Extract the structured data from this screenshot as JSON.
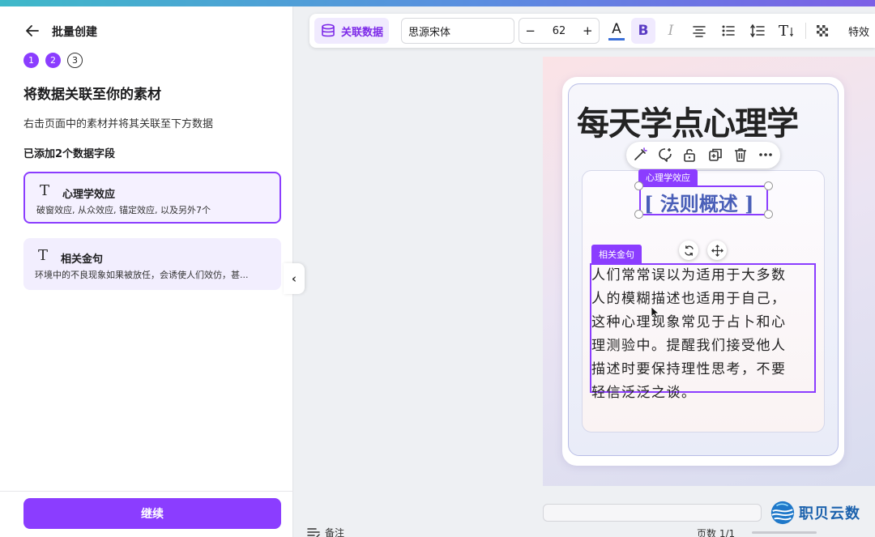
{
  "header": {
    "title": "批量创建"
  },
  "steps": [
    "1",
    "2",
    "3"
  ],
  "section": {
    "title": "将数据关联至你的素材",
    "description": "右击页面中的素材并将其关联至下方数据",
    "added_count_label": "已添加2个数据字段"
  },
  "fields": [
    {
      "icon": "T",
      "name": "心理学效应",
      "values": "破窗效应, 从众效应, 锚定效应, 以及另外7个",
      "selected": true
    },
    {
      "icon": "T",
      "name": "相关金句",
      "values": "环境中的不良现象如果被放任，会诱使人们效仿，甚...",
      "selected": false
    }
  ],
  "continue_label": "继续",
  "toolbar": {
    "link_data_label": "关联数据",
    "font_name": "思源宋体",
    "font_size": "62",
    "minus": "−",
    "plus": "+",
    "color_glyph": "A",
    "bold_glyph": "B",
    "italic_glyph": "I",
    "textfx_glyph": "T",
    "effects_label": "特效",
    "text_color": "#3a6fd8",
    "accent": "#8b3dff"
  },
  "canvas": {
    "title": "每天学点心理学",
    "tag_effect": "心理学效应",
    "law_text": "[ 法则概述 ]",
    "tag_quote": "相关金句",
    "quote_lines": [
      "人们常常误以为适用于大多数",
      "人的模糊描述也适用于自己，",
      "这种心理现象常见于占卜和心",
      "理测验中。提醒我们接受他人",
      "描述时要保持理性思考，不要",
      "轻信泛泛之谈。"
    ]
  },
  "bottom": {
    "notes_label": "备注",
    "page_count": "页数 1/1"
  },
  "watermark": {
    "text": "职贝云数"
  }
}
